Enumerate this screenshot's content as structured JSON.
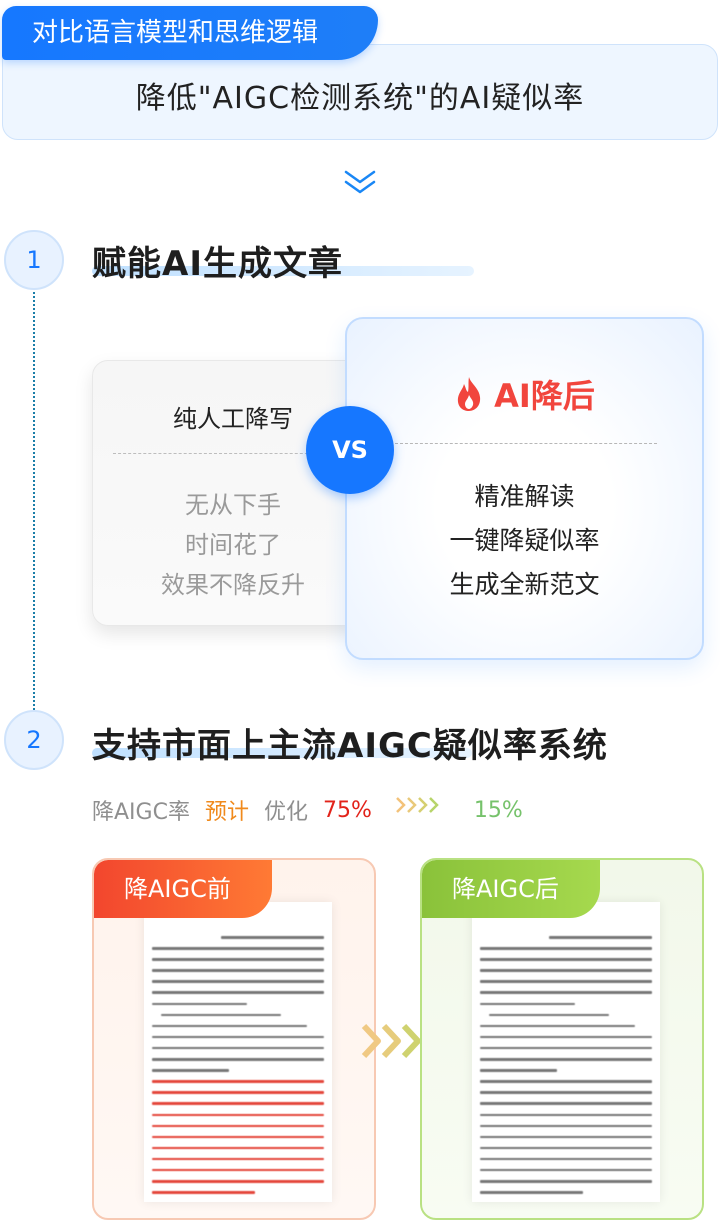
{
  "banner": {
    "tag": "对比语言模型和思维逻辑",
    "subtitle": "降低\"AIGC检测系统\"的AI疑似率"
  },
  "steps": [
    {
      "number": "1",
      "title": "赋能AI生成文章"
    },
    {
      "number": "2",
      "title": "支持市面上主流AIGC疑似率系统"
    }
  ],
  "compare": {
    "left": {
      "title": "纯人工降写",
      "items": [
        "无从下手",
        "时间花了",
        "效果不降反升"
      ]
    },
    "vs": "VS",
    "right": {
      "title": "AI降后",
      "items": [
        "精准解读",
        "一键降疑似率",
        "生成全新范文"
      ]
    }
  },
  "stats": {
    "label": "降AIGC率",
    "forecast": "预计",
    "optimize": "优化",
    "before": "75%",
    "after": "15%"
  },
  "docs": {
    "before_label": "降AIGC前",
    "after_label": "降AIGC后"
  },
  "colors": {
    "primary_blue": "#1677ff",
    "red": "#e2231a",
    "orange": "#f08a1c",
    "green": "#76c26b"
  },
  "icons": [
    "chevron-double-down-icon",
    "fire-icon",
    "arrows-right-icon"
  ]
}
